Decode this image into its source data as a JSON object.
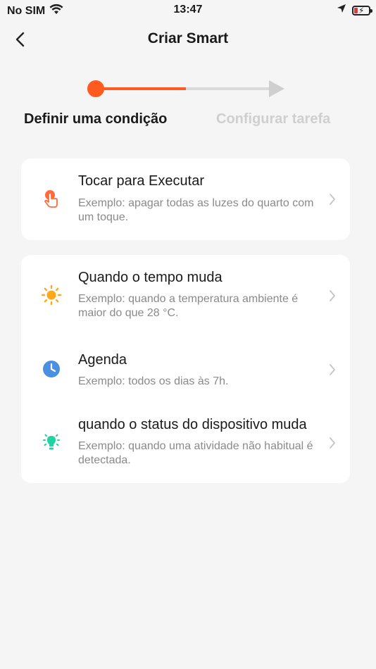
{
  "status_bar": {
    "carrier": "No SIM",
    "time": "13:47"
  },
  "header": {
    "title": "Criar Smart"
  },
  "stepper": {
    "step1_label": "Definir uma condição",
    "step2_label": "Configurar tarefa",
    "active_color": "#ff5a1f",
    "inactive_color": "#d9d9d9"
  },
  "conditions": {
    "tap_to_run": {
      "title": "Tocar para Executar",
      "description": "Exemplo: apagar todas as luzes do quarto com um toque.",
      "icon": "hand-tap-icon"
    },
    "weather_changes": {
      "title": "Quando o tempo muda",
      "description": "Exemplo: quando a temperatura ambiente é maior do que 28 °C.",
      "icon": "sun-icon"
    },
    "schedule": {
      "title": "Agenda",
      "description": "Exemplo: todos os dias às 7h.",
      "icon": "clock-icon"
    },
    "device_status_changes": {
      "title": "quando o status do dispositivo muda",
      "description": "Exemplo: quando uma atividade não habitual é detectada.",
      "icon": "bulb-icon"
    }
  }
}
